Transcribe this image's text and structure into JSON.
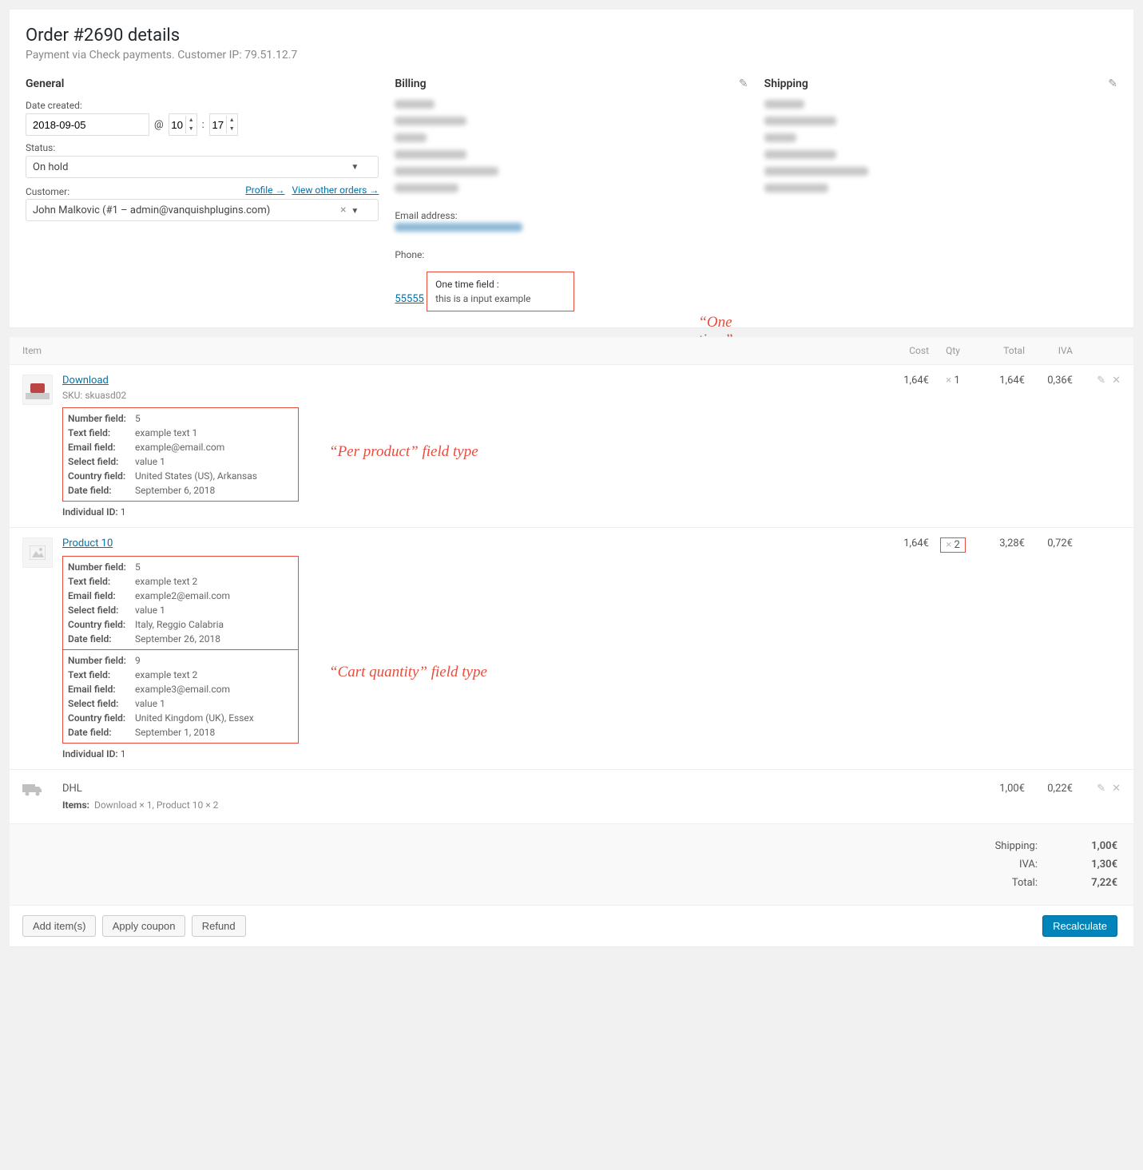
{
  "header": {
    "title": "Order #2690 details",
    "subtitle": "Payment via Check payments. Customer IP: 79.51.12.7"
  },
  "general": {
    "title": "General",
    "date_label": "Date created:",
    "date_value": "2018-09-05",
    "at": "@",
    "hour": "10",
    "colon": ":",
    "minute": "17",
    "status_label": "Status:",
    "status_value": "On hold",
    "customer_label": "Customer:",
    "profile_link": "Profile →",
    "other_orders_link": "View other orders →",
    "customer_value": "John Malkovic (#1 – admin@vanquishplugins.com)"
  },
  "billing": {
    "title": "Billing",
    "email_label": "Email address:",
    "phone_label": "Phone:",
    "phone_value": "55555",
    "onetime_label": "One time field :",
    "onetime_value": "this is a input example"
  },
  "shipping": {
    "title": "Shipping"
  },
  "callouts": {
    "onetime": "“One time” field type",
    "perproduct": "“Per product” field type",
    "cartqty": "“Cart quantity” field type"
  },
  "items_header": {
    "item": "Item",
    "cost": "Cost",
    "qty": "Qty",
    "total": "Total",
    "iva": "IVA"
  },
  "items": [
    {
      "name": "Download",
      "sku_label": "SKU:",
      "sku": "skuasd02",
      "cost": "1,64€",
      "qty_prefix": "×",
      "qty": "1",
      "total": "1,64€",
      "iva": "0,36€",
      "fields": [
        {
          "label": "Number field:",
          "value": "5"
        },
        {
          "label": "Text field:",
          "value": "example text 1"
        },
        {
          "label": "Email field:",
          "value": "example@email.com"
        },
        {
          "label": "Select field:",
          "value": "value 1"
        },
        {
          "label": "Country field:",
          "value": "United States (US), Arkansas"
        },
        {
          "label": "Date field:",
          "value": "September 6, 2018"
        }
      ],
      "indiv_label": "Individual ID:",
      "indiv_value": "1"
    },
    {
      "name": "Product 10",
      "cost": "1,64€",
      "qty_prefix": "×",
      "qty": "2",
      "total": "3,28€",
      "iva": "0,72€",
      "fields1": [
        {
          "label": "Number field:",
          "value": "5"
        },
        {
          "label": "Text field:",
          "value": "example text 2"
        },
        {
          "label": "Email field:",
          "value": "example2@email.com"
        },
        {
          "label": "Select field:",
          "value": "value 1"
        },
        {
          "label": "Country field:",
          "value": "Italy, Reggio Calabria"
        },
        {
          "label": "Date field:",
          "value": "September 26, 2018"
        }
      ],
      "fields2": [
        {
          "label": "Number field:",
          "value": "9"
        },
        {
          "label": "Text field:",
          "value": "example text 2"
        },
        {
          "label": "Email field:",
          "value": "example3@email.com"
        },
        {
          "label": "Select field:",
          "value": "value 1"
        },
        {
          "label": "Country field:",
          "value": "United Kingdom (UK), Essex"
        },
        {
          "label": "Date field:",
          "value": "September 1, 2018"
        }
      ],
      "indiv_label": "Individual ID:",
      "indiv_value": "1"
    }
  ],
  "shipping_row": {
    "name": "DHL",
    "items_label": "Items:",
    "items_value": "Download × 1, Product 10 × 2",
    "total": "1,00€",
    "iva": "0,22€"
  },
  "totals": {
    "shipping_label": "Shipping:",
    "shipping_value": "1,00€",
    "iva_label": "IVA:",
    "iva_value": "1,30€",
    "total_label": "Total:",
    "total_value": "7,22€"
  },
  "actions": {
    "add": "Add item(s)",
    "coupon": "Apply coupon",
    "refund": "Refund",
    "recalc": "Recalculate"
  }
}
